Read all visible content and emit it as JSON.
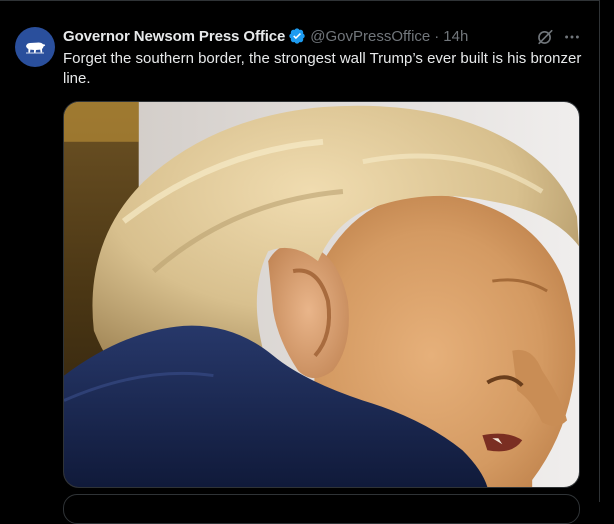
{
  "tweet": {
    "author": {
      "display_name": "Governor Newsom Press Office",
      "handle": "@GovPressOffice",
      "verified": true,
      "avatar_icon": "california-bear-icon",
      "avatar_color": "#2a4f9c"
    },
    "separator": "·",
    "timestamp": "14h",
    "text": "Forget the southern border, the strongest wall Trump’s ever built is his bronzer line.",
    "actions": {
      "grok_icon": "grok-icon",
      "more_icon": "more-options-icon"
    },
    "media": {
      "type": "photo"
    }
  },
  "colors": {
    "background": "#000000",
    "primary_text": "#e7e9ea",
    "secondary_text": "#71767b",
    "verified_blue": "#1d9bf0",
    "divider": "#2f3336"
  }
}
